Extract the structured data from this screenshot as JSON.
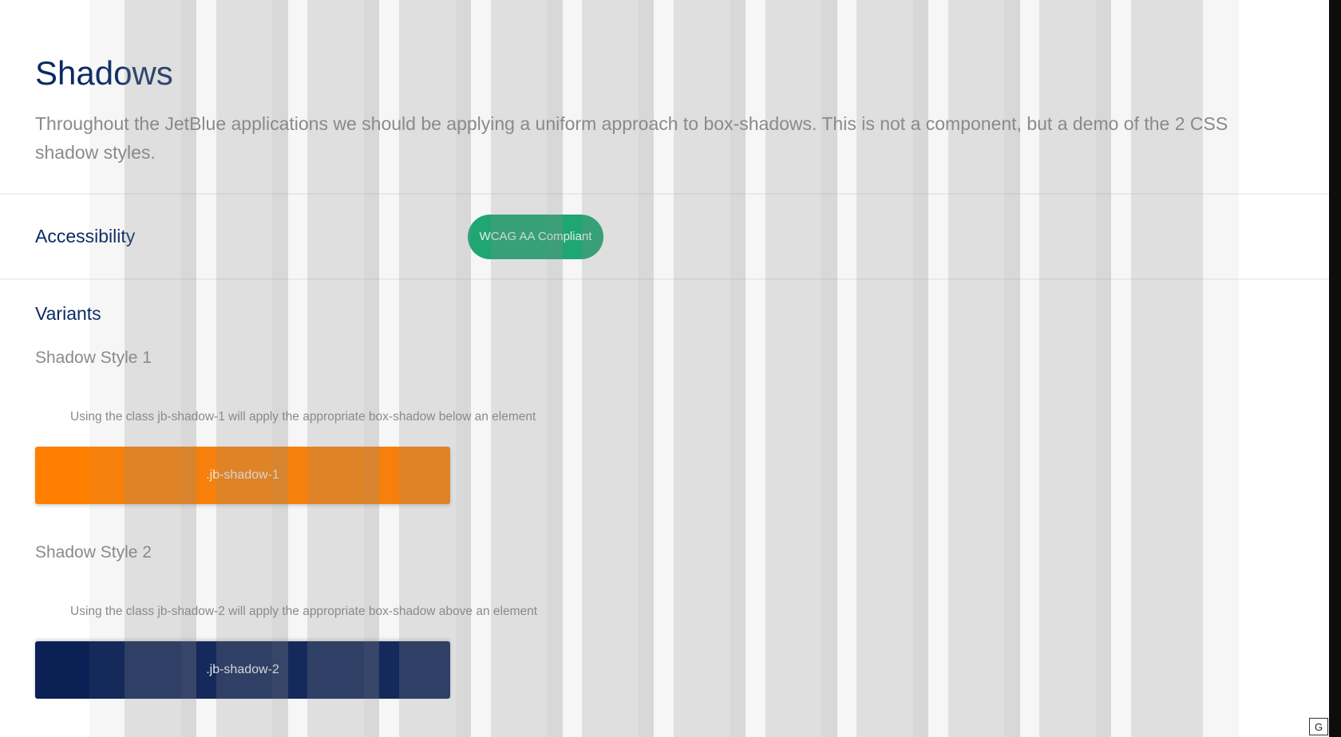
{
  "page": {
    "title": "Shadows",
    "intro": "Throughout the JetBlue applications we should be applying a uniform approach to box-shadows. This is not a component, but a demo of the 2 CSS shadow styles."
  },
  "accessibility": {
    "label": "Accessibility",
    "badge": "WCAG AA Compliant",
    "badge_color": "#16a970"
  },
  "variants": {
    "label": "Variants",
    "items": [
      {
        "heading": "Shadow Style 1",
        "description": "Using the class jb-shadow-1 will apply the appropriate box-shadow below an element",
        "demo_label": ".jb-shadow-1",
        "color": "#ff7f00"
      },
      {
        "heading": "Shadow Style 2",
        "description": "Using the class jb-shadow-2 will apply the appropriate box-shadow above an element",
        "demo_label": ".jb-shadow-2",
        "color": "#0b2156"
      }
    ]
  },
  "grid_toggle": {
    "label": "G"
  },
  "colors": {
    "heading": "#0b2a63",
    "body_text": "#8a8a8a"
  }
}
